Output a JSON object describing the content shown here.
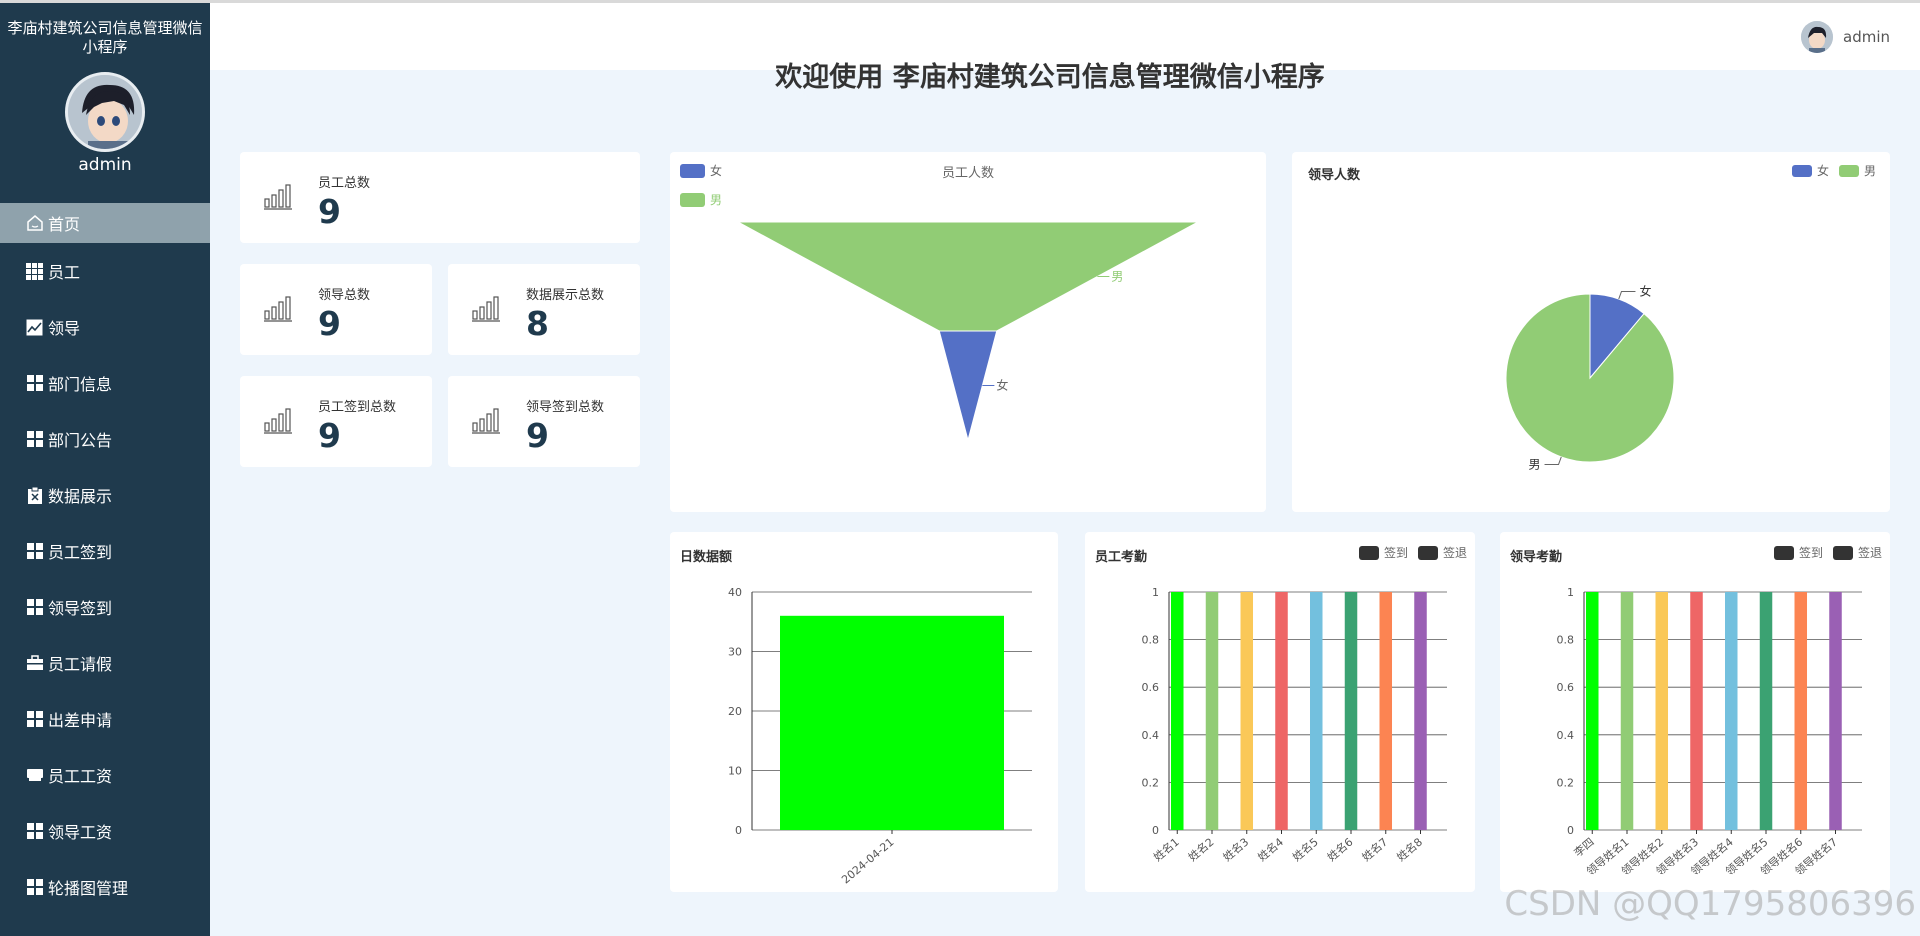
{
  "app": {
    "title": "李庙村建筑公司信息管理微信小程序",
    "user": "admin"
  },
  "header": {
    "user": "admin"
  },
  "welcome": "欢迎使用 李庙村建筑公司信息管理微信小程序",
  "menu": [
    {
      "label": "首页",
      "icon": "home-icon"
    },
    {
      "label": "员工",
      "icon": "grid-icon"
    },
    {
      "label": "领导",
      "icon": "chart-icon"
    },
    {
      "label": "部门信息",
      "icon": "grid-icon"
    },
    {
      "label": "部门公告",
      "icon": "grid-icon"
    },
    {
      "label": "数据展示",
      "icon": "clipboard-icon"
    },
    {
      "label": "员工签到",
      "icon": "grid-icon"
    },
    {
      "label": "领导签到",
      "icon": "grid-icon"
    },
    {
      "label": "员工请假",
      "icon": "briefcase-icon"
    },
    {
      "label": "出差申请",
      "icon": "grid-icon"
    },
    {
      "label": "员工工资",
      "icon": "wallet-icon"
    },
    {
      "label": "领导工资",
      "icon": "grid-icon"
    },
    {
      "label": "轮播图管理",
      "icon": "grid-icon"
    }
  ],
  "stats": [
    {
      "label": "员工总数",
      "value": "9"
    },
    {
      "label": "领导总数",
      "value": "9"
    },
    {
      "label": "数据展示总数",
      "value": "8"
    },
    {
      "label": "员工签到总数",
      "value": "9"
    },
    {
      "label": "领导签到总数",
      "value": "9"
    }
  ],
  "colors": {
    "female": "#5470c6",
    "male": "#91cc75",
    "sidebar": "#1f3a4d",
    "active": "#8fa2ac"
  },
  "chart_data": [
    {
      "type": "funnel",
      "title": "员工人数",
      "legend": [
        "女",
        "男"
      ],
      "categories": [
        "男",
        "女"
      ],
      "values": [
        8,
        1
      ],
      "colors": [
        "#91cc75",
        "#5470c6"
      ]
    },
    {
      "type": "pie",
      "title": "领导人数",
      "legend": [
        "女",
        "男"
      ],
      "categories": [
        "女",
        "男"
      ],
      "values": [
        1,
        8
      ],
      "colors": [
        "#5470c6",
        "#91cc75"
      ]
    },
    {
      "type": "bar",
      "title": "日数据额",
      "categories": [
        "2024-04-21"
      ],
      "values": [
        36
      ],
      "ylim": [
        0,
        40
      ],
      "yticks": [
        "0",
        "10",
        "20",
        "30",
        "40"
      ],
      "colors": [
        "#00ff00"
      ]
    },
    {
      "type": "bar",
      "title": "员工考勤",
      "legend": [
        "签到",
        "签退"
      ],
      "categories": [
        "姓名1",
        "姓名2",
        "姓名3",
        "姓名4",
        "姓名5",
        "姓名6",
        "姓名7",
        "姓名8"
      ],
      "values": [
        1,
        1,
        1,
        1,
        1,
        1,
        1,
        1
      ],
      "ylim": [
        0,
        1
      ],
      "yticks": [
        "0",
        "0.2",
        "0.4",
        "0.6",
        "0.8",
        "1"
      ],
      "colors": [
        "#00ff00",
        "#91cc75",
        "#fac858",
        "#ee6666",
        "#73c0de",
        "#3ba272",
        "#fc8452",
        "#9a60b4"
      ]
    },
    {
      "type": "bar",
      "title": "领导考勤",
      "legend": [
        "签到",
        "签退"
      ],
      "categories": [
        "李四",
        "领导姓名1",
        "领导姓名2",
        "领导姓名3",
        "领导姓名4",
        "领导姓名5",
        "领导姓名6",
        "领导姓名7"
      ],
      "values": [
        1,
        1,
        1,
        1,
        1,
        1,
        1,
        1
      ],
      "ylim": [
        0,
        1
      ],
      "yticks": [
        "0",
        "0.2",
        "0.4",
        "0.6",
        "0.8",
        "1"
      ],
      "colors": [
        "#00ff00",
        "#91cc75",
        "#fac858",
        "#ee6666",
        "#73c0de",
        "#3ba272",
        "#fc8452",
        "#9a60b4"
      ]
    }
  ],
  "watermark": "CSDN @QQ1795806396"
}
